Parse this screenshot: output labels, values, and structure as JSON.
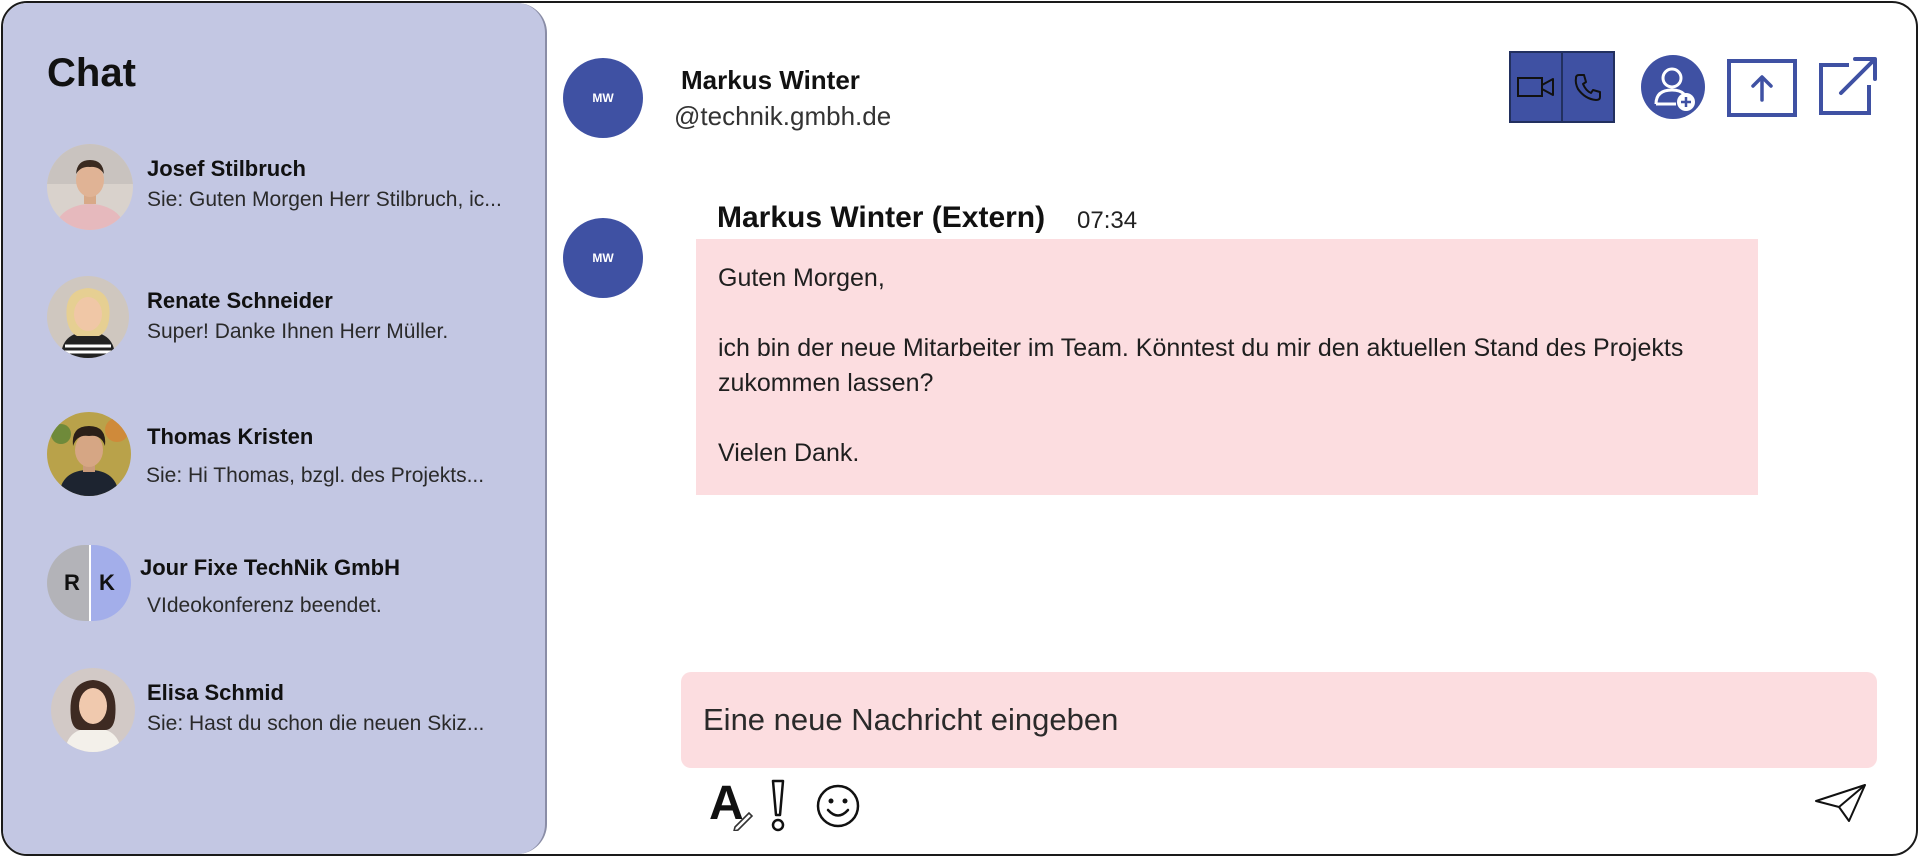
{
  "sidebar": {
    "title": "Chat",
    "chats": [
      {
        "name": "Josef Stilbruch",
        "preview": "Sie: Guten Morgen Herr Stilbruch, ic..."
      },
      {
        "name": "Renate Schneider",
        "preview": "Super! Danke Ihnen Herr Müller."
      },
      {
        "name": "Thomas Kristen",
        "preview": "Sie: Hi Thomas, bzgl. des Projekts..."
      },
      {
        "name": "Jour Fixe TechNik GmbH",
        "preview": "VIdeokonferenz beendet.",
        "initials_left": "R",
        "initials_right": "K"
      },
      {
        "name": "Elisa Schmid",
        "preview": "Sie: Hast du schon die neuen Skiz..."
      }
    ]
  },
  "header": {
    "avatar_initials": "MW",
    "contact_name": "Markus Winter",
    "contact_handle": "@technik.gmbh.de",
    "icons": [
      "video-icon",
      "phone-icon",
      "add-person-icon",
      "share-upload-icon",
      "popout-icon"
    ]
  },
  "message": {
    "avatar_initials": "MW",
    "sender": "Markus Winter (Extern)",
    "time": "07:34",
    "lines": [
      "Guten Morgen,",
      "ich bin der neue Mitarbeiter im Team. Könntest du mir den aktuellen Stand des Projekts zukommen lassen?",
      "Vielen Dank."
    ]
  },
  "composer": {
    "placeholder": "Eine neue Nachricht eingeben",
    "tools": [
      "format-text-icon",
      "important-icon",
      "emoji-icon",
      "send-icon"
    ]
  },
  "colors": {
    "sidebar_bg": "#c3c7e3",
    "accent": "#3f51a3",
    "bubble_bg": "#fcdde0"
  }
}
